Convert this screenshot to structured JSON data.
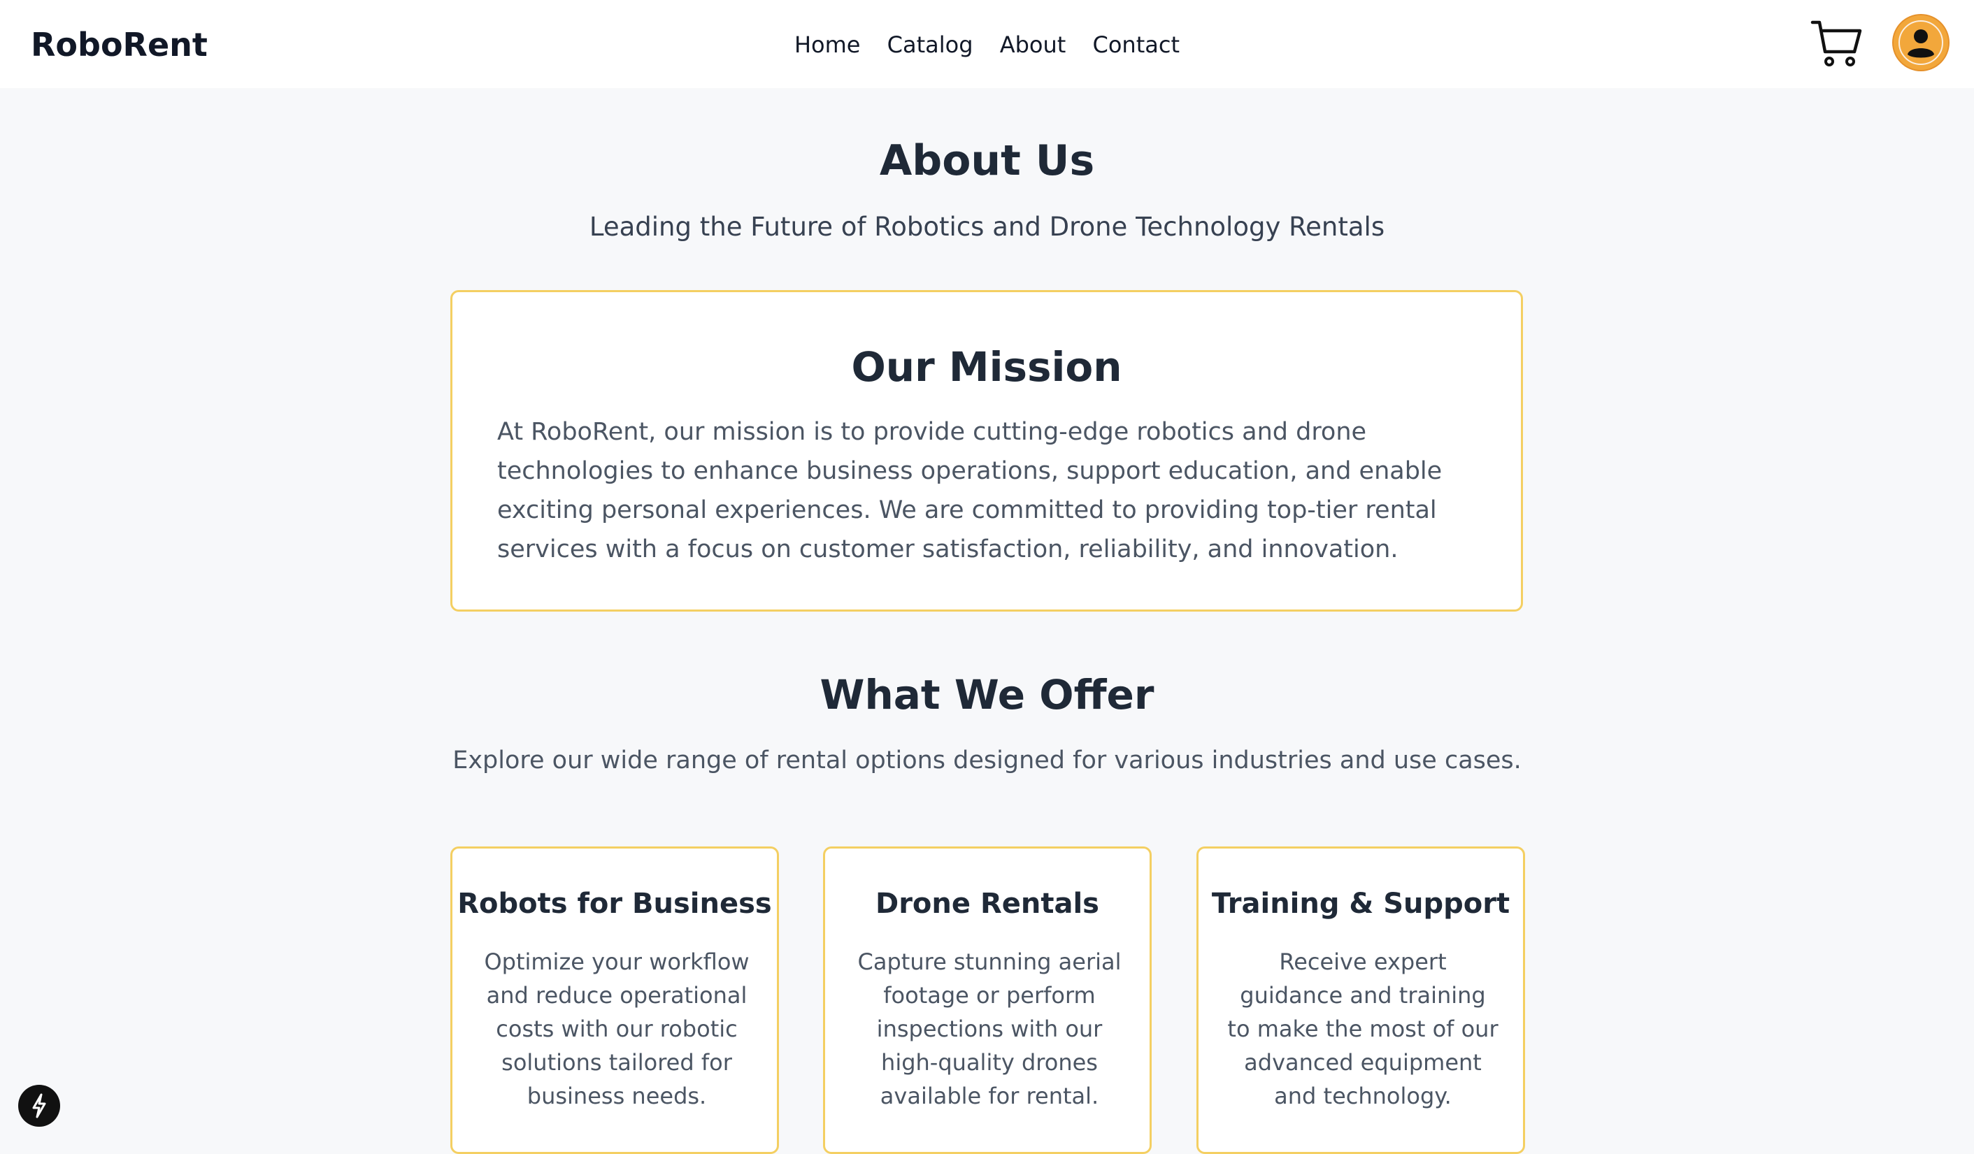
{
  "header": {
    "brand": "RoboRent",
    "nav": [
      "Home",
      "Catalog",
      "About",
      "Contact"
    ],
    "cart_icon": "cart-icon",
    "avatar_icon": "user-avatar-icon",
    "accent": "#f2a73b"
  },
  "hero": {
    "title": "About Us",
    "subtitle": "Leading the Future of Robotics and Drone Technology Rentals"
  },
  "mission": {
    "title": "Our Mission",
    "text": "At RoboRent, our mission is to provide cutting-edge robotics and drone technologies to enhance business operations, support education, and enable exciting personal experiences. We are committed to providing top-tier rental services with a focus on customer satisfaction, reliability, and innovation.",
    "border_color": "#f4cf62"
  },
  "offer": {
    "title": "What We Offer",
    "subtitle": "Explore our wide range of rental options designed for various industries and use cases.",
    "cards": [
      {
        "title": "Robots for Business",
        "text": "Optimize your workflow and reduce operational costs with our robotic solutions tailored for business needs."
      },
      {
        "title": "Drone Rentals",
        "text": "Capture stunning aerial footage or perform inspections with our high-quality drones available for rental."
      },
      {
        "title": "Training & Support",
        "text": "Receive expert guidance and training to make the most of our advanced equipment and technology."
      }
    ]
  },
  "floating_button": {
    "icon": "lightning-icon"
  }
}
